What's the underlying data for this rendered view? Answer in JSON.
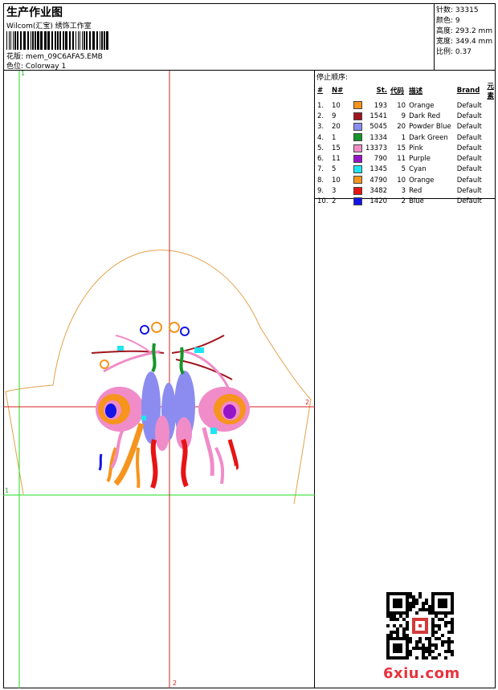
{
  "header": {
    "title": "生产作业图",
    "studio": "Wilcom(汇宝) 绣饰工作室",
    "design_label": "花版:",
    "design_file": "mem_09C6AFA5.EMB",
    "colorway_label": "色位:",
    "colorway": "Colorway 1"
  },
  "stats": [
    {
      "label": "针数:",
      "value": "33315"
    },
    {
      "label": "颜色:",
      "value": "9"
    },
    {
      "label": "高度:",
      "value": "293.2 mm"
    },
    {
      "label": "宽度:",
      "value": "349.4 mm"
    },
    {
      "label": "比例:",
      "value": "0.37"
    }
  ],
  "color_table": {
    "title": "停止顺序:",
    "headers": [
      "#",
      "N#",
      "St.",
      "代码",
      "描述",
      "Brand",
      "元素"
    ],
    "rows": [
      {
        "idx": "1.",
        "n": "10",
        "color": "#f7941d",
        "st": "193",
        "code": "10",
        "desc": "Orange",
        "brand": "Default"
      },
      {
        "idx": "2.",
        "n": "9",
        "color": "#a0141e",
        "st": "1541",
        "code": "9",
        "desc": "Dark Red",
        "brand": "Default"
      },
      {
        "idx": "3.",
        "n": "20",
        "color": "#8c8cf0",
        "st": "5045",
        "code": "20",
        "desc": "Powder Blue",
        "brand": "Default"
      },
      {
        "idx": "4.",
        "n": "1",
        "color": "#149628",
        "st": "1334",
        "code": "1",
        "desc": "Dark Green",
        "brand": "Default"
      },
      {
        "idx": "5.",
        "n": "15",
        "color": "#f08cc8",
        "st": "13373",
        "code": "15",
        "desc": "Pink",
        "brand": "Default"
      },
      {
        "idx": "6.",
        "n": "11",
        "color": "#9614c8",
        "st": "790",
        "code": "11",
        "desc": "Purple",
        "brand": "Default"
      },
      {
        "idx": "7.",
        "n": "5",
        "color": "#1ee6f0",
        "st": "1345",
        "code": "5",
        "desc": "Cyan",
        "brand": "Default"
      },
      {
        "idx": "8.",
        "n": "10",
        "color": "#f7941d",
        "st": "4790",
        "code": "10",
        "desc": "Orange",
        "brand": "Default"
      },
      {
        "idx": "9.",
        "n": "3",
        "color": "#e61414",
        "st": "3482",
        "code": "3",
        "desc": "Red",
        "brand": "Default"
      },
      {
        "idx": "10.",
        "n": "2",
        "color": "#1414e6",
        "st": "1420",
        "code": "2",
        "desc": "Blue",
        "brand": "Default"
      }
    ]
  },
  "guides": {
    "v1": "1",
    "h1": "1",
    "v2": "2",
    "h2": "2"
  },
  "watermark": "6xiu.com"
}
